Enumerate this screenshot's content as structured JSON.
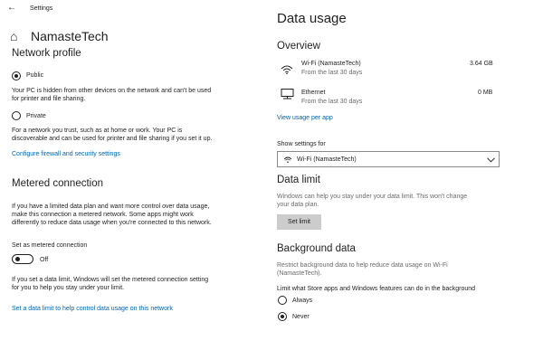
{
  "window": {
    "back_glyph": "←",
    "title": "Settings"
  },
  "left": {
    "home_glyph": "⌂",
    "network_name": "NamasteTech",
    "network_profile": {
      "heading": "Network profile",
      "public": {
        "label": "Public",
        "desc1": "Your PC is hidden from other devices on the network and can't be used",
        "desc2": "for printer and file sharing."
      },
      "private": {
        "label": "Private",
        "desc1": "For a network you trust, such as at home or work. Your PC is",
        "desc2": "discoverable and can be used for printer and file sharing if you set it up."
      },
      "firewall_link": "Configure firewall and security settings"
    },
    "metered": {
      "heading": "Metered connection",
      "desc1": "If you have a limited data plan and want more control over data usage,",
      "desc2": "make this connection a metered network. Some apps might work",
      "desc3": "differently to reduce data usage when you're connected to this network.",
      "set_label": "Set as metered connection",
      "toggle_state": "Off",
      "limit1": "If you set a data limit, Windows will set the metered connection setting",
      "limit2": "for you to help you stay under your limit.",
      "limit_link": "Set a data limit to help control data usage on this network"
    }
  },
  "right": {
    "title": "Data usage",
    "overview": {
      "heading": "Overview",
      "items": [
        {
          "name": "Wi-Fi (NamasteTech)",
          "sub": "From the last 30 days",
          "amount": "3.64 GB"
        },
        {
          "name": "Ethernet",
          "sub": "From the last 30 days",
          "amount": "0 MB"
        }
      ],
      "view_link": "View usage per app"
    },
    "show_settings": {
      "label": "Show settings for",
      "selected": "Wi-Fi (NamasteTech)"
    },
    "data_limit": {
      "heading": "Data limit",
      "desc1": "Windows can help you stay under your data limit. This won't change",
      "desc2": "your data plan.",
      "button": "Set limit"
    },
    "background": {
      "heading": "Background data",
      "desc1": "Restrict background data to help reduce data usage on Wi-Fi",
      "desc2": "(NamasteTech).",
      "limit_label": "Limit what Store apps and Windows features can do in the background",
      "always": "Always",
      "never": "Never"
    }
  },
  "colors": {
    "link": "#0063b1",
    "button_bg": "#cccccc",
    "text": "#1f1f1f",
    "muted": "#6b6b6b"
  }
}
